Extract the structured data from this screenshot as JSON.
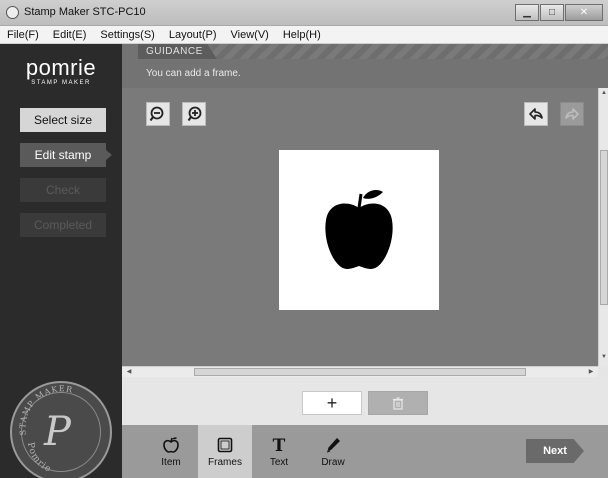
{
  "window": {
    "title": "Stamp Maker STC-PC10",
    "controls": [
      "minimize",
      "maximize",
      "close"
    ]
  },
  "menu": [
    "File(F)",
    "Edit(E)",
    "Settings(S)",
    "Layout(P)",
    "View(V)",
    "Help(H)"
  ],
  "brand": {
    "logo": "pomrie",
    "subtitle": "STAMP MAKER"
  },
  "steps": [
    {
      "label": "Select size",
      "state": "done"
    },
    {
      "label": "Edit stamp",
      "state": "active"
    },
    {
      "label": "Check",
      "state": "disabled"
    },
    {
      "label": "Completed",
      "state": "disabled"
    }
  ],
  "seal": {
    "text_top": "STAMP MAKER",
    "text_bottom": "Pomrie",
    "letter": "P"
  },
  "guidance": {
    "tab": "GUIDANCE",
    "message": "You can add a frame."
  },
  "canvas_tools": {
    "zoom_out": "zoom-out-icon",
    "zoom_in": "zoom-in-icon",
    "undo": "undo-icon",
    "redo": "redo-icon"
  },
  "stamp": {
    "image": "apple-icon"
  },
  "actions": {
    "add": "+",
    "delete": "trash-icon"
  },
  "bottom_tools": [
    {
      "label": "Item",
      "icon": "apple-outline-icon",
      "active": false
    },
    {
      "label": "Frames",
      "icon": "frame-icon",
      "active": true
    },
    {
      "label": "Text",
      "icon": "text-icon",
      "active": false
    },
    {
      "label": "Draw",
      "icon": "pen-icon",
      "active": false
    }
  ],
  "next": "Next",
  "colors": {
    "sidebar": "#2b2b2b",
    "canvas": "#7a7a7a",
    "toolbar": "#9a9a9a"
  }
}
